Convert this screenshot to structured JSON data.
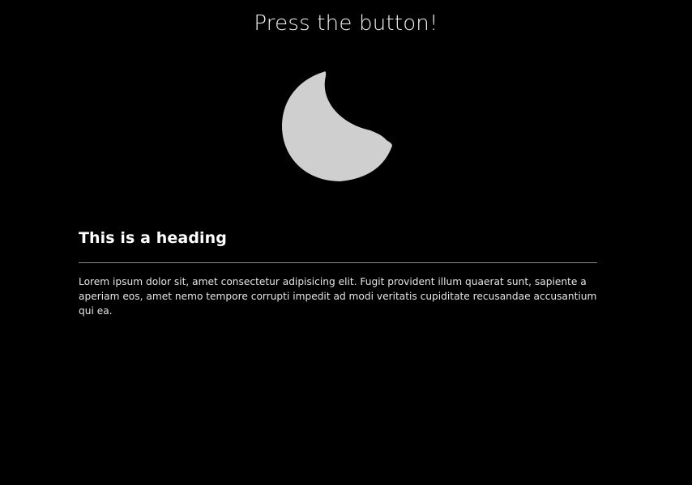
{
  "header": {
    "prompt": "Press the button!"
  },
  "toggle": {
    "icon": "moon-icon",
    "color": "#cfcfcf"
  },
  "article": {
    "heading": "This is a heading",
    "body": "Lorem ipsum dolor sit, amet consectetur adipisicing elit. Fugit provident illum quaerat sunt, sapiente a aperiam eos, amet nemo tempore corrupti impedit ad modi veritatis cupiditate recusandae accusantium qui ea."
  },
  "theme": {
    "background": "#000000",
    "text": "#ffffff",
    "divider": "#8a8a8a"
  }
}
